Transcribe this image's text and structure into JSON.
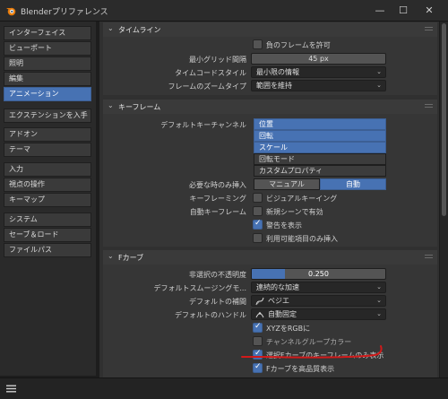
{
  "window": {
    "title": "Blenderプリファレンス",
    "controls": {
      "minimize": "—",
      "maximize": "☐",
      "close": "✕"
    }
  },
  "sidebar": {
    "items": [
      {
        "label": "インターフェイス",
        "active": false
      },
      {
        "label": "ビューポート",
        "active": false
      },
      {
        "label": "照明",
        "active": false
      },
      {
        "label": "編集",
        "active": false
      },
      {
        "label": "アニメーション",
        "active": true
      },
      {
        "label": "エクステンションを入手",
        "active": false
      },
      {
        "label": "アドオン",
        "active": false
      },
      {
        "label": "テーマ",
        "active": false
      },
      {
        "label": "入力",
        "active": false
      },
      {
        "label": "視点の操作",
        "active": false
      },
      {
        "label": "キーマップ",
        "active": false
      },
      {
        "label": "システム",
        "active": false
      },
      {
        "label": "セーブ＆ロード",
        "active": false
      },
      {
        "label": "ファイルパス",
        "active": false
      }
    ]
  },
  "timeline": {
    "header": "タイムライン",
    "allow_negative_frames": {
      "label": "負のフレームを許可",
      "checked": false
    },
    "min_grid_spacing": {
      "label": "最小グリッド間隔",
      "value": "45 px"
    },
    "timecode_style": {
      "label": "タイムコードスタイル",
      "value": "最小限の情報"
    },
    "zoom_to_frame_type": {
      "label": "フレームのズームタイプ",
      "value": "範囲を維持"
    }
  },
  "keyframes": {
    "header": "キーフレーム",
    "default_key_channels": {
      "label": "デフォルトキーチャンネル",
      "items": [
        {
          "label": "位置",
          "selected": true
        },
        {
          "label": "回転",
          "selected": true
        },
        {
          "label": "スケール",
          "selected": true
        },
        {
          "label": "回転モード",
          "selected": false
        },
        {
          "label": "カスタムプロパティ",
          "selected": false
        }
      ]
    },
    "only_insert_needed": {
      "label": "必要な時のみ挿入",
      "options": [
        "マニュアル",
        "自動"
      ],
      "selected": "自動"
    },
    "keyframing": {
      "label": "キーフレーミング",
      "visual_keying": {
        "label": "ビジュアルキーイング",
        "checked": false
      }
    },
    "auto_keyframing": {
      "label": "自動キーフレーム",
      "new_scenes": {
        "label": "新規シーンで有効",
        "checked": false
      },
      "show_warning": {
        "label": "警告を表示",
        "checked": true
      },
      "only_available": {
        "label": "利用可能項目のみ挿入",
        "checked": false
      }
    }
  },
  "fcurves": {
    "header": "Fカーブ",
    "unselected_opacity": {
      "label": "非選択の不透明度",
      "value": "0.250",
      "fraction": 0.25
    },
    "default_smoothing": {
      "label": "デフォルトスムージングモ...",
      "value": "連続的な加速"
    },
    "default_interpolation": {
      "label": "デフォルトの補間",
      "value": "ベジエ",
      "icon": "bezier-curve-icon"
    },
    "default_handles": {
      "label": "デフォルトのハンドル",
      "value": "自動固定",
      "icon": "auto-handle-icon"
    },
    "xyz_to_rgb": {
      "label": "XYZをRGBに",
      "checked": true
    },
    "use_channel_group_colors": {
      "label": "チャンネルグループカラー",
      "checked": false
    },
    "only_selected_keyframes": {
      "label": "選択Fカーブのキーフレームのみ表示",
      "checked": true
    },
    "high_quality_display": {
      "label": "Fカーブを高品質表示",
      "checked": true
    }
  },
  "colors": {
    "accent": "#4772b3",
    "annotation": "#d11a1a"
  }
}
